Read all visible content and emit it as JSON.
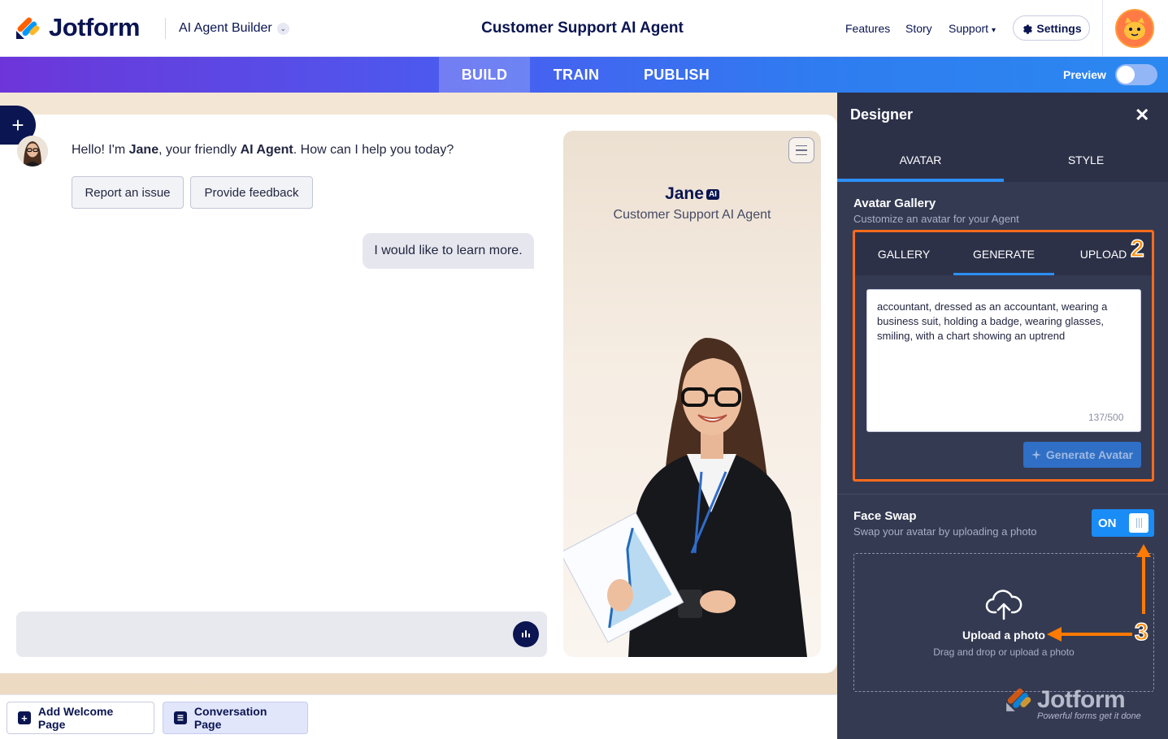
{
  "brand": {
    "name": "Jotform"
  },
  "header": {
    "product": "AI Agent Builder",
    "title": "Customer Support AI Agent",
    "nav": [
      "Features",
      "Story",
      "Support"
    ],
    "settings_label": "Settings"
  },
  "modes": {
    "tabs": [
      "BUILD",
      "TRAIN",
      "PUBLISH"
    ],
    "active": "BUILD",
    "preview_label": "Preview"
  },
  "chat": {
    "greeting_prefix": "Hello! I'm ",
    "agent_name": "Jane",
    "greeting_mid": ", your friendly ",
    "agent_type": "AI Agent",
    "greeting_suffix": ". How can I help you today?",
    "quick_replies": [
      "Report an issue",
      "Provide feedback"
    ],
    "user_message": "I would like to learn more."
  },
  "agent_card": {
    "name": "Jane",
    "badge": "AI",
    "role": "Customer Support AI Agent"
  },
  "bottom": {
    "add_welcome": "Add Welcome Page",
    "conversation": "Conversation Page"
  },
  "designer": {
    "title": "Designer",
    "tabs": [
      "AVATAR",
      "STYLE"
    ],
    "gallery_title": "Avatar Gallery",
    "gallery_sub": "Customize an avatar for your Agent",
    "sub_tabs": [
      "GALLERY",
      "GENERATE",
      "UPLOAD"
    ],
    "prompt": "accountant, dressed as an accountant, wearing a business suit, holding a badge, wearing glasses, smiling, with a chart showing an uptrend",
    "counter": "137/500",
    "generate_label": "Generate Avatar",
    "face_swap_title": "Face Swap",
    "face_swap_sub": "Swap your avatar by uploading a photo",
    "toggle_label": "ON",
    "upload_label": "Upload a photo",
    "upload_sub": "Drag and drop or upload a photo"
  },
  "watermark": {
    "name": "Jotform",
    "tagline": "Powerful forms get it done"
  },
  "annotations": [
    "2",
    "3"
  ],
  "colors": {
    "accent": "#2c8ff5",
    "highlight": "#ff6b1a",
    "navy": "#0a1551"
  }
}
